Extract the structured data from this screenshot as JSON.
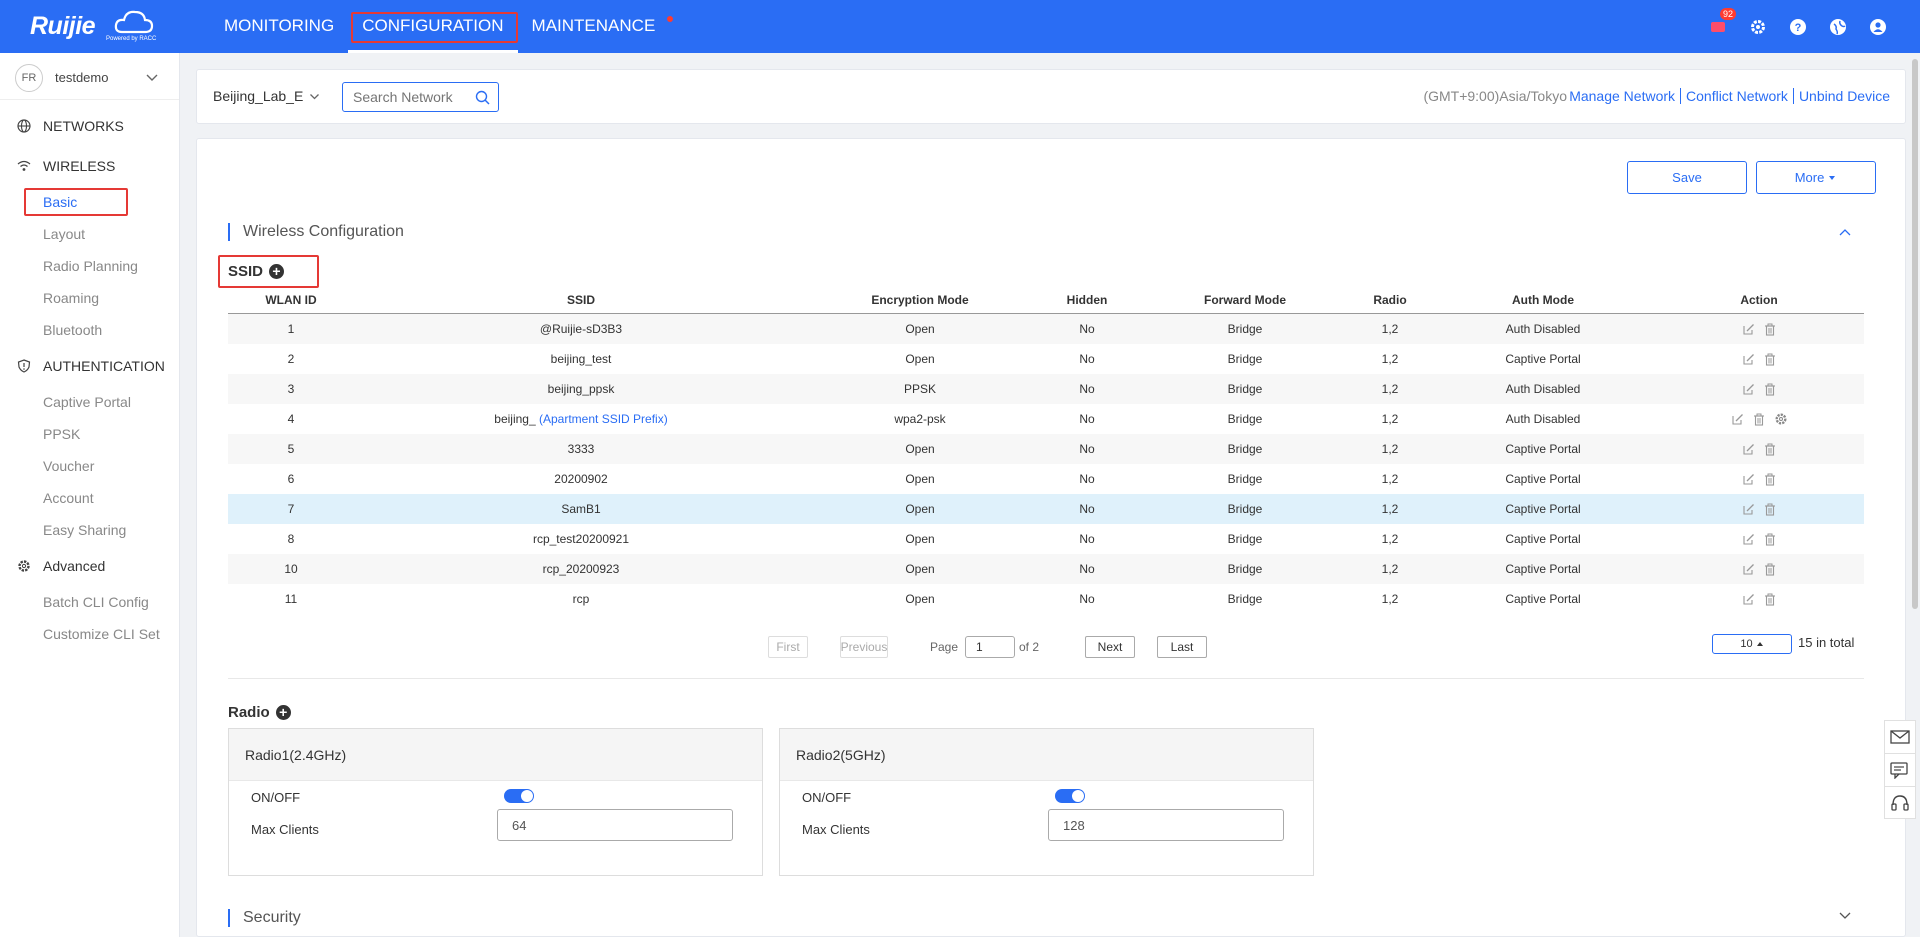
{
  "brand": {
    "name": "Ruijie",
    "powered": "Powered by RACC"
  },
  "topnav": [
    {
      "label": "MONITORING",
      "active": false
    },
    {
      "label": "CONFIGURATION",
      "active": true
    },
    {
      "label": "MAINTENANCE",
      "active": false,
      "dot": true
    }
  ],
  "top_icons": {
    "notification_count": "92"
  },
  "user": {
    "avatar_initials": "FR",
    "name": "testdemo"
  },
  "sidebar": {
    "networks": "NETWORKS",
    "wireless": {
      "label": "WIRELESS",
      "items": [
        "Basic",
        "Layout",
        "Radio Planning",
        "Roaming",
        "Bluetooth"
      ]
    },
    "authentication": {
      "label": "AUTHENTICATION",
      "items": [
        "Captive Portal",
        "PPSK",
        "Voucher",
        "Account",
        "Easy Sharing"
      ]
    },
    "advanced": {
      "label": "Advanced",
      "items": [
        "Batch CLI Config",
        "Customize CLI Set"
      ]
    }
  },
  "netbar": {
    "network": "Beijing_Lab_E",
    "search_placeholder": "Search Network",
    "timezone": "(GMT+9:00)Asia/Tokyo",
    "links": [
      "Manage Network",
      "Conflict Network",
      "Unbind Device"
    ]
  },
  "toolbar": {
    "save": "Save",
    "more": "More"
  },
  "wireless_config": {
    "title": "Wireless Configuration"
  },
  "ssid": {
    "title": "SSID",
    "columns": [
      "WLAN ID",
      "SSID",
      "Encryption Mode",
      "Hidden",
      "Forward Mode",
      "Radio",
      "Auth Mode",
      "Action"
    ],
    "rows": [
      {
        "id": "1",
        "ssid": "@Ruijie-sD3B3",
        "prefix": "",
        "enc": "Open",
        "hidden": "No",
        "forward": "Bridge",
        "radio": "1,2",
        "auth": "Auth Disabled",
        "gear": false
      },
      {
        "id": "2",
        "ssid": "beijing_test",
        "prefix": "",
        "enc": "Open",
        "hidden": "No",
        "forward": "Bridge",
        "radio": "1,2",
        "auth": "Captive Portal",
        "gear": false
      },
      {
        "id": "3",
        "ssid": "beijing_ppsk",
        "prefix": "",
        "enc": "PPSK",
        "hidden": "No",
        "forward": "Bridge",
        "radio": "1,2",
        "auth": "Auth Disabled",
        "gear": false
      },
      {
        "id": "4",
        "ssid": "beijing_",
        "prefix": "(Apartment SSID Prefix)",
        "enc": "wpa2-psk",
        "hidden": "No",
        "forward": "Bridge",
        "radio": "1,2",
        "auth": "Auth Disabled",
        "gear": true
      },
      {
        "id": "5",
        "ssid": "3333",
        "prefix": "",
        "enc": "Open",
        "hidden": "No",
        "forward": "Bridge",
        "radio": "1,2",
        "auth": "Captive Portal",
        "gear": false
      },
      {
        "id": "6",
        "ssid": "20200902",
        "prefix": "",
        "enc": "Open",
        "hidden": "No",
        "forward": "Bridge",
        "radio": "1,2",
        "auth": "Captive Portal",
        "gear": false
      },
      {
        "id": "7",
        "ssid": "SamB1",
        "prefix": "",
        "enc": "Open",
        "hidden": "No",
        "forward": "Bridge",
        "radio": "1,2",
        "auth": "Captive Portal",
        "gear": false,
        "selected": true
      },
      {
        "id": "8",
        "ssid": "rcp_test20200921",
        "prefix": "",
        "enc": "Open",
        "hidden": "No",
        "forward": "Bridge",
        "radio": "1,2",
        "auth": "Captive Portal",
        "gear": false
      },
      {
        "id": "10",
        "ssid": "rcp_20200923",
        "prefix": "",
        "enc": "Open",
        "hidden": "No",
        "forward": "Bridge",
        "radio": "1,2",
        "auth": "Captive Portal",
        "gear": false
      },
      {
        "id": "11",
        "ssid": "rcp",
        "prefix": "",
        "enc": "Open",
        "hidden": "No",
        "forward": "Bridge",
        "radio": "1,2",
        "auth": "Captive Portal",
        "gear": false
      }
    ]
  },
  "pager": {
    "first": "First",
    "previous": "Previous",
    "page_label": "Page",
    "current": "1",
    "of": "of 2",
    "next": "Next",
    "last": "Last",
    "page_size": "10",
    "total": "15 in total"
  },
  "radio": {
    "title": "Radio",
    "cards": [
      {
        "title": "Radio1(2.4GHz)",
        "onoff_label": "ON/OFF",
        "on": true,
        "max_label": "Max Clients",
        "max_value": "64"
      },
      {
        "title": "Radio2(5GHz)",
        "onoff_label": "ON/OFF",
        "on": true,
        "max_label": "Max Clients",
        "max_value": "128"
      }
    ]
  },
  "security": {
    "title": "Security"
  },
  "colors": {
    "primary": "#2a6df4",
    "highlight": "#e53935",
    "selected_row": "#dff1fb"
  }
}
